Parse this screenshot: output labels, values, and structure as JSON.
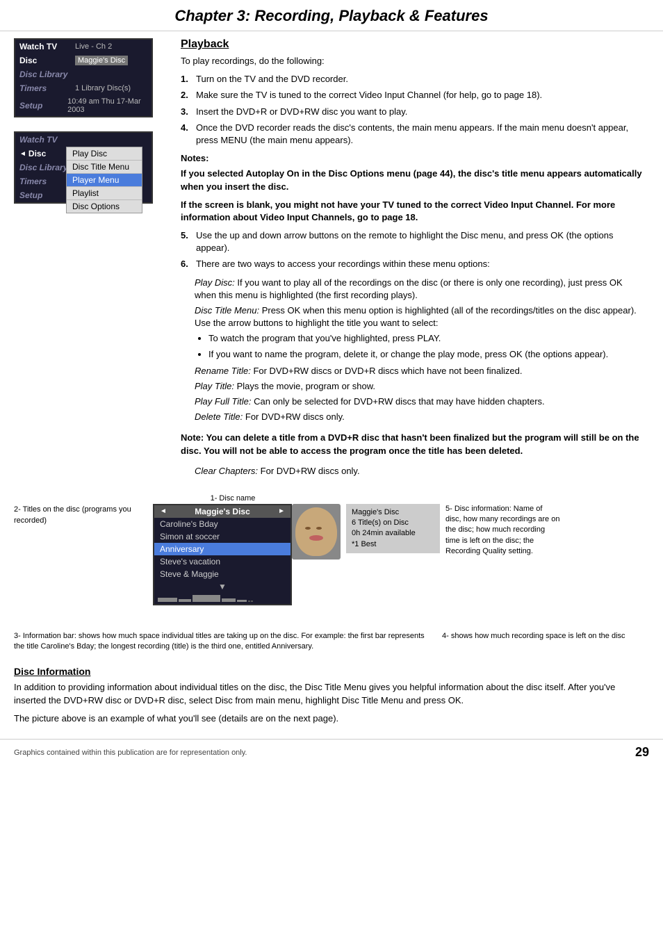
{
  "header": {
    "title": "Chapter 3: Recording, Playback & Features"
  },
  "main_menu": {
    "items": [
      {
        "label": "Watch TV",
        "value": "Live - Ch 2",
        "state": "active"
      },
      {
        "label": "Disc",
        "value": "Maggie's Disc",
        "state": "highlighted"
      },
      {
        "label": "Disc Library",
        "value": "",
        "state": "normal"
      },
      {
        "label": "Timers",
        "value": "1 Library Disc(s)",
        "state": "normal"
      },
      {
        "label": "Setup",
        "value": "10:49 am Thu 17-Mar 2003",
        "state": "normal"
      }
    ]
  },
  "disc_menu": {
    "parent_items": [
      {
        "label": "Watch TV",
        "state": "dimmed"
      },
      {
        "label": "Disc",
        "state": "active"
      },
      {
        "label": "Disc Library",
        "state": "dimmed"
      },
      {
        "label": "Timers",
        "state": "dimmed"
      },
      {
        "label": "Setup",
        "state": "dimmed"
      }
    ],
    "sub_items": [
      {
        "label": "Play Disc",
        "state": "normal"
      },
      {
        "label": "Disc Title Menu",
        "state": "normal"
      },
      {
        "label": "Player Menu",
        "state": "highlighted"
      },
      {
        "label": "Playlist",
        "state": "normal"
      },
      {
        "label": "Disc Options",
        "state": "normal"
      }
    ]
  },
  "playback": {
    "title": "Playback",
    "intro": "To play recordings, do the following:",
    "steps": [
      {
        "num": "1.",
        "text": "Turn on the TV and the DVD recorder."
      },
      {
        "num": "2.",
        "text": "Make sure the TV is tuned to the correct Video Input Channel (for help, go to page 18)."
      },
      {
        "num": "3.",
        "text": "Insert the DVD+R or DVD+RW disc you want to play."
      },
      {
        "num": "4.",
        "text": "Once the DVD recorder reads the disc's contents, the main menu appears. If the main menu doesn't appear, press MENU (the main menu appears)."
      }
    ],
    "notes_label": "Notes:",
    "note1": "If you selected Autoplay On in the Disc Options menu (page 44), the disc's title menu appears automatically when you insert the disc.",
    "note2": "If the screen is blank, you might not have your TV tuned to the correct Video Input Channel. For more information about Video Input Channels, go to page 18.",
    "step5": {
      "num": "5.",
      "text": "Use the up and down arrow buttons on the remote to highlight the Disc menu, and press OK (the options appear)."
    },
    "step6_intro": {
      "num": "6.",
      "text": "There are two ways to access your recordings within these menu options:"
    },
    "sub_options": [
      {
        "title": "Play Disc:",
        "text": "If you want to play all of the recordings on the disc (or there is only one recording), just press OK when this menu is highlighted (the first recording plays)."
      },
      {
        "title": "Disc Title Menu:",
        "text": "Press OK when this menu option is highlighted (all of the recordings/titles on the disc appear). Use the arrow buttons to highlight the title you want to select:"
      }
    ],
    "bullets": [
      "To watch the program that you've highlighted, press PLAY.",
      "If you want to name the program, delete it, or change the play mode, press OK (the options appear)."
    ],
    "rename_title": "Rename Title:",
    "rename_text": "For DVD+RW discs or DVD+R discs which have not been finalized.",
    "play_title_label": "Play Title:",
    "play_title_text": "Plays the movie, program or show.",
    "play_full_label": "Play Full Title:",
    "play_full_text": "Can only be selected for DVD+RW discs that may have hidden chapters.",
    "delete_title_label": "Delete Title:",
    "delete_title_text": "For DVD+RW discs only.",
    "note_bold": "Note: You can delete a title from a DVD+R disc that hasn't been finalized but the program will still be on the disc. You will not be able to access the program once the title has been deleted.",
    "clear_chapters_label": "Clear Chapters:",
    "clear_chapters_text": "For DVD+RW discs only."
  },
  "disc_diagram": {
    "label1": "1- Disc name",
    "label2": "2- Titles on the disc (programs you recorded)",
    "label3": "3- Information bar: shows how much space individual titles are taking up on the disc. For example: the first bar represents the title Caroline's Bday; the longest recording (title) is the third one, entitled Anniversary.",
    "label4": "4- shows how much recording space is left on the disc",
    "label5": "5- Disc information: Name of disc, how many recordings are on the disc; how much recording time is left on the disc; the Recording Quality setting.",
    "disc_name": "Maggie's Disc",
    "titles": [
      {
        "name": "Caroline's Bday",
        "selected": false
      },
      {
        "name": "Simon at soccer",
        "selected": false
      },
      {
        "name": "Anniversary",
        "selected": true
      },
      {
        "name": "Steve's vacation",
        "selected": false
      },
      {
        "name": "Steve & Maggie",
        "selected": false
      }
    ],
    "disc_info": {
      "name": "Maggie's Disc",
      "titles_count": "6 Title(s) on Disc",
      "time_available": "0h 24min available",
      "quality": "*1 Best"
    }
  },
  "disc_info_section": {
    "title": "Disc Information",
    "text1": "In addition to providing information about individual titles on the disc, the Disc Title Menu gives you helpful information about the disc itself. After you've inserted the DVD+RW disc or DVD+R disc, select Disc from main menu, highlight Disc Title Menu and press OK.",
    "text2": "The picture above is an example of what you'll see (details are on the next page)."
  },
  "footer": {
    "text": "Graphics contained within this publication are for representation only.",
    "page_number": "29"
  }
}
